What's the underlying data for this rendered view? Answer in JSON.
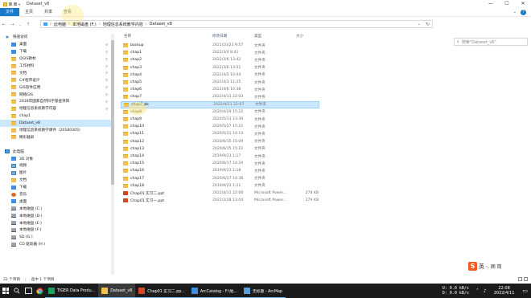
{
  "window": {
    "title": "Dataset_v8",
    "controls": [
      "—",
      "☐",
      "✕"
    ]
  },
  "ribbon": {
    "tabs": [
      "文件",
      "主页",
      "共享",
      "查看"
    ],
    "help": "?"
  },
  "address": {
    "crumbs": [
      "此电脑",
      "本地磁盘 (F:)",
      "地理信息系统教学内容",
      "Dataset_v8"
    ],
    "search_placeholder": "搜索\"Dataset_v8\""
  },
  "nav": {
    "items": [
      {
        "label": "快速访问",
        "icon": "star",
        "pin": false
      },
      {
        "label": "桌面",
        "icon": "blue",
        "pin": true
      },
      {
        "label": "下载",
        "icon": "blue",
        "pin": true
      },
      {
        "label": "QGIS教材",
        "icon": "folder",
        "pin": true
      },
      {
        "label": "工作材料",
        "icon": "folder",
        "pin": true
      },
      {
        "label": "文档",
        "icon": "folder",
        "pin": true
      },
      {
        "label": "C#程序设计",
        "icon": "folder",
        "pin": true
      },
      {
        "label": "GIS软件应用",
        "icon": "folder",
        "pin": true
      },
      {
        "label": "网络GIS",
        "icon": "folder",
        "pin": true
      },
      {
        "label": "2018年国家自然科学基金项目",
        "icon": "folder",
        "pin": true
      },
      {
        "label": "地理信息系统教学内容",
        "icon": "folder",
        "pin": true
      },
      {
        "label": "chap1",
        "icon": "folder",
        "pin": false
      },
      {
        "label": "Dataset_v8",
        "icon": "folder",
        "pin": false,
        "selected": true
      },
      {
        "label": "地理信息系统教学课件（20180305)",
        "icon": "folder",
        "pin": false
      },
      {
        "label": "精彩截屏",
        "icon": "folder",
        "pin": false
      },
      {
        "label": "",
        "icon": "none",
        "pin": false
      },
      {
        "label": "此电脑",
        "icon": "pc",
        "pin": false
      },
      {
        "label": "3D 对象",
        "icon": "blue",
        "pin": false
      },
      {
        "label": "视频",
        "icon": "img",
        "pin": false
      },
      {
        "label": "图片",
        "icon": "img",
        "pin": false
      },
      {
        "label": "文档",
        "icon": "folder",
        "pin": false
      },
      {
        "label": "下载",
        "icon": "blue",
        "pin": false
      },
      {
        "label": "音乐",
        "icon": "music",
        "pin": false
      },
      {
        "label": "桌面",
        "icon": "blue",
        "pin": false
      },
      {
        "label": "本地磁盘 (C:)",
        "icon": "drive",
        "pin": false
      },
      {
        "label": "本地磁盘 (D:)",
        "icon": "drive",
        "pin": false
      },
      {
        "label": "本地磁盘 (E:)",
        "icon": "drive",
        "pin": false
      },
      {
        "label": "本地磁盘 (F:)",
        "icon": "drive",
        "pin": false
      },
      {
        "label": "SD (G:)",
        "icon": "drive",
        "pin": false
      },
      {
        "label": "CD 驱动器 (H:)",
        "icon": "drive",
        "pin": false
      }
    ]
  },
  "list": {
    "headers": {
      "name": "名称",
      "date": "修改日期",
      "type": "类型",
      "size": "大小"
    },
    "rows": [
      {
        "name": "backup",
        "date": "2021/10/23 9:57",
        "type": "文件夹",
        "size": "",
        "icon": "folder"
      },
      {
        "name": "chap1",
        "date": "2022/3/4 8:41",
        "type": "文件夹",
        "size": "",
        "icon": "folder"
      },
      {
        "name": "chap2",
        "date": "2022/3/6 13:42",
        "type": "文件夹",
        "size": "",
        "icon": "folder"
      },
      {
        "name": "chap3",
        "date": "2022/3/6 13:51",
        "type": "文件夹",
        "size": "",
        "icon": "folder"
      },
      {
        "name": "chap4",
        "date": "2022/4/2 10:44",
        "type": "文件夹",
        "size": "",
        "icon": "folder"
      },
      {
        "name": "chap5",
        "date": "2022/4/3 11:25",
        "type": "文件夹",
        "size": "",
        "icon": "folder"
      },
      {
        "name": "chap6",
        "date": "2022/4/6 10:38",
        "type": "文件夹",
        "size": "",
        "icon": "folder"
      },
      {
        "name": "chap7",
        "date": "2022/4/11 22:03",
        "type": "文件夹",
        "size": "",
        "icon": "folder"
      },
      {
        "name": "chap7_bk",
        "date": "2022/4/11 22:07",
        "type": "文件夹",
        "size": "",
        "icon": "folder",
        "selected": true
      },
      {
        "name": "chap8",
        "date": "2020/4/29 15:22",
        "type": "文件夹",
        "size": "",
        "icon": "folder"
      },
      {
        "name": "chap9",
        "date": "2020/5/13 13:30",
        "type": "文件夹",
        "size": "",
        "icon": "folder"
      },
      {
        "name": "chap10",
        "date": "2020/5/27 15:22",
        "type": "文件夹",
        "size": "",
        "icon": "folder"
      },
      {
        "name": "chap11",
        "date": "2020/5/31 14:13",
        "type": "文件夹",
        "size": "",
        "icon": "folder"
      },
      {
        "name": "chap12",
        "date": "2020/6/15 15:09",
        "type": "文件夹",
        "size": "",
        "icon": "folder"
      },
      {
        "name": "chap13",
        "date": "2020/6/15 15:22",
        "type": "文件夹",
        "size": "",
        "icon": "folder"
      },
      {
        "name": "chap14",
        "date": "2019/9/23 1:17",
        "type": "文件夹",
        "size": "",
        "icon": "folder"
      },
      {
        "name": "chap15",
        "date": "2020/6/17 14:24",
        "type": "文件夹",
        "size": "",
        "icon": "folder"
      },
      {
        "name": "chap16",
        "date": "2019/9/23 1:18",
        "type": "文件夹",
        "size": "",
        "icon": "folder"
      },
      {
        "name": "chap17",
        "date": "2020/6/17 14:36",
        "type": "文件夹",
        "size": "",
        "icon": "folder"
      },
      {
        "name": "chap18",
        "date": "2019/9/23 1:21",
        "type": "文件夹",
        "size": "",
        "icon": "folder"
      },
      {
        "name": "Chap01 实习二.ppt",
        "date": "2022/4/11 22:06",
        "type": "Microsoft Power...",
        "size": "278 KB",
        "icon": "ppt"
      },
      {
        "name": "Chap01 实习一.ppt",
        "date": "2022/2/28 13:04",
        "type": "Microsoft Power...",
        "size": "279 KB",
        "icon": "ppt"
      }
    ]
  },
  "status": {
    "count": "22 个项目",
    "selected": "选中 1 个项目"
  },
  "taskbar": {
    "apps": [
      {
        "label": "TIGER Data Produ...",
        "color": "#1aa260",
        "active": false
      },
      {
        "label": "Dataset_v8",
        "color": "#f3c04a",
        "active": true
      },
      {
        "label": "Chap01 实习二.pp...",
        "color": "#d24726",
        "active": false
      },
      {
        "label": "ArcCatalog - F:\\地...",
        "color": "#3d8ee0",
        "active": false
      },
      {
        "label": "无标题 - ArcMap",
        "color": "#5aa0e0",
        "active": false
      }
    ],
    "net_up": "U:   0.0 kB/s",
    "net_down": "D:   0.0 kB/s",
    "time": "22:08",
    "date": "2022/4/11"
  },
  "ime": {
    "logo": "S",
    "mode": "英",
    "tray": "·, 囲 简"
  },
  "colors": {
    "accent": "#1979ca",
    "selection": "#cce8ff",
    "folder": "#f3c04a",
    "ppt": "#d24726",
    "taskbar": "#1b1b1b"
  }
}
